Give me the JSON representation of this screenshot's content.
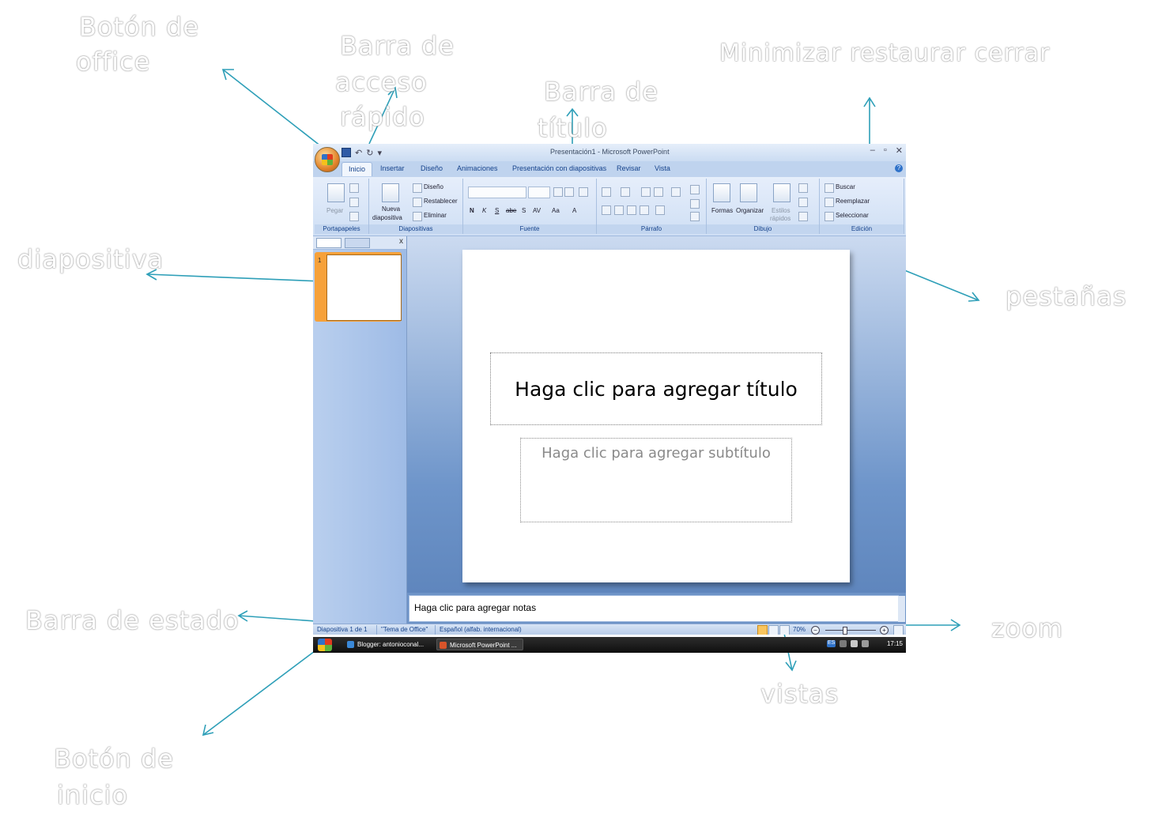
{
  "callouts": {
    "office_button": [
      "Botón de",
      "office"
    ],
    "quick_access": [
      "Barra de",
      "acceso",
      "rápido"
    ],
    "title_bar": [
      "Barra de",
      "título"
    ],
    "window_controls": "Minimizar restaurar cerrar",
    "slide": "diapositiva",
    "tabs": "pestañas",
    "status_bar": "Barra de estado",
    "zoom": "zoom",
    "views": "vistas",
    "start_button": [
      "Botón de",
      "inicio"
    ]
  },
  "window": {
    "title": "Presentación1 - Microsoft PowerPoint",
    "tabs": [
      "Inicio",
      "Insertar",
      "Diseño",
      "Animaciones",
      "Presentación con diapositivas",
      "Revisar",
      "Vista"
    ],
    "active_tab": "Inicio"
  },
  "ribbon": {
    "portapapeles": {
      "label": "Portapapeles",
      "paste": "Pegar"
    },
    "diapositivas": {
      "label": "Diapositivas",
      "new_slide": [
        "Nueva",
        "diapositiva"
      ],
      "layout": "Diseño",
      "reset": "Restablecer",
      "delete": "Eliminar"
    },
    "fuente": {
      "label": "Fuente",
      "bold": "N",
      "italic": "K",
      "underline": "S",
      "strike": "abe",
      "shadow": "S",
      "spacing": "AV",
      "case": "Aa",
      "color": "A"
    },
    "parrafo": {
      "label": "Párrafo"
    },
    "dibujo": {
      "label": "Dibujo",
      "shapes": "Formas",
      "arrange": "Organizar",
      "styles": [
        "Estilos",
        "rápidos"
      ]
    },
    "edicion": {
      "label": "Edición",
      "find": "Buscar",
      "replace": "Reemplazar",
      "select": "Seleccionar"
    }
  },
  "slide_panel": {
    "slide_number": "1"
  },
  "slide": {
    "title_placeholder": "Haga clic para agregar título",
    "subtitle_placeholder": "Haga clic para agregar subtítulo"
  },
  "notes_placeholder": "Haga clic para agregar notas",
  "status": {
    "slide_count": "Diapositiva 1 de 1",
    "theme": "\"Tema de Office\"",
    "language": "Español (alfab. internacional)",
    "zoom": "70%",
    "zoom_level_percent": 70
  },
  "taskbar": {
    "items": [
      "Blogger: antonioconal...",
      "Microsoft PowerPoint ..."
    ],
    "language": "ES",
    "time": "17:15"
  },
  "colors": {
    "arrow": "#2e9fb8",
    "window_bg": "#6d93c7",
    "accent_orange": "#f6a13a"
  }
}
